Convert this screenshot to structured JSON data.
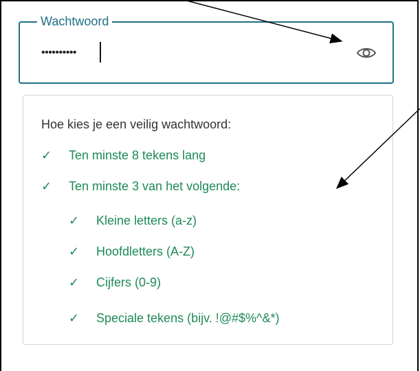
{
  "password_field": {
    "legend": "Wachtwoord",
    "masked_value": "••••••••••",
    "toggle_icon": "eye-icon"
  },
  "requirements": {
    "title": "Hoe kies je een veilig wachtwoord:",
    "check_symbol": "✓",
    "items": [
      {
        "label": "Ten minste 8 tekens lang",
        "met": true,
        "level": 0
      },
      {
        "label": "Ten minste 3 van het volgende:",
        "met": true,
        "level": 0
      },
      {
        "label": "Kleine letters (a-z)",
        "met": true,
        "level": 1
      },
      {
        "label": "Hoofdletters (A-Z)",
        "met": true,
        "level": 1
      },
      {
        "label": "Cijfers (0-9)",
        "met": true,
        "level": 1
      },
      {
        "label": "Speciale tekens (bijv. !@#$%^&*)",
        "met": true,
        "level": 1
      }
    ]
  },
  "colors": {
    "field_border": "#1e6f86",
    "requirement_met": "#1e8a57",
    "annotation_arrow": "#000000"
  }
}
